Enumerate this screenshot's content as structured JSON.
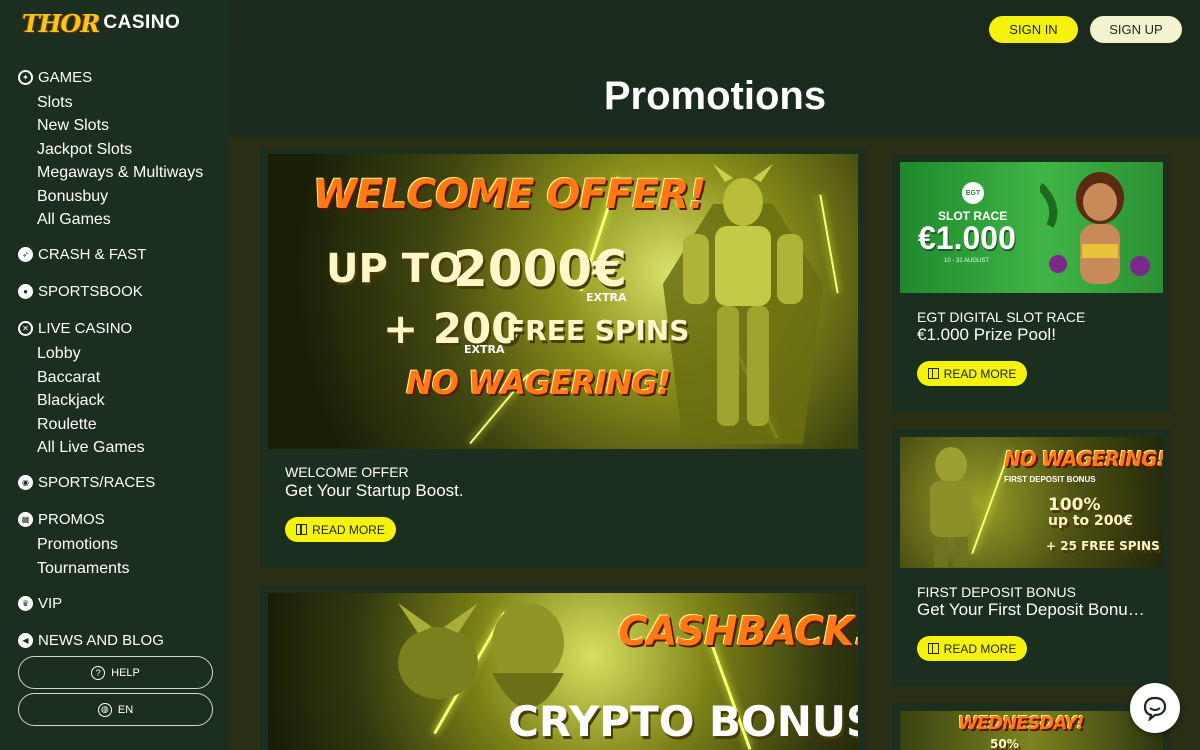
{
  "brand": {
    "logo_part1": "THOR",
    "logo_part2": "CASINO",
    "accent": "#f5f20e"
  },
  "header": {
    "sign_in": "SIGN IN",
    "sign_up": "SIGN UP"
  },
  "page_title": "Promotions",
  "sidebar": {
    "sections": [
      {
        "label": "GAMES",
        "icon": "games-icon",
        "items": [
          "Slots",
          "New Slots",
          "Jackpot Slots",
          "Megaways & Multiways",
          "Bonusbuy",
          "All Games"
        ]
      },
      {
        "label": "CRASH & FAST",
        "icon": "rocket-icon",
        "items": []
      },
      {
        "label": "SPORTSBOOK",
        "icon": "football-icon",
        "items": []
      },
      {
        "label": "LIVE CASINO",
        "icon": "chip-icon",
        "items": [
          "Lobby",
          "Baccarat",
          "Blackjack",
          "Roulette",
          "All Live Games"
        ]
      },
      {
        "label": "SPORTS/RACES",
        "icon": "gamepad-icon",
        "items": []
      },
      {
        "label": "PROMOS",
        "icon": "gift-icon",
        "items": [
          "Promotions",
          "Tournaments"
        ]
      },
      {
        "label": "VIP",
        "icon": "crown-icon",
        "items": []
      },
      {
        "label": "NEWS AND BLOG",
        "icon": "megaphone-icon",
        "items": []
      }
    ],
    "help_label": "HELP",
    "language_label": "EN"
  },
  "promos": {
    "welcome": {
      "kicker": "WELCOME OFFER",
      "subtitle": "Get Your Startup Boost.",
      "read_more": "READ MORE",
      "banner": {
        "title": "WELCOME OFFER!",
        "line1a": "UP TO",
        "line1b": "2000€",
        "extra1": "EXTRA",
        "line2a": "+ 200",
        "line2b": "FREE SPINS",
        "extra2": "EXTRA",
        "line3": "NO WAGERING!"
      }
    },
    "egt": {
      "kicker": "EGT DIGITAL SLOT RACE",
      "subtitle": "€1.000 Prize Pool!",
      "read_more": "READ MORE",
      "banner": {
        "badge": "EGT",
        "label": "SLOT RACE",
        "amount": "€1.000",
        "dates": "10 - 31 AUGUST"
      }
    },
    "first_deposit": {
      "kicker": "FIRST DEPOSIT BONUS",
      "subtitle": "Get Your First Deposit Bonus…",
      "read_more": "READ MORE",
      "banner": {
        "title": "NO WAGERING!!",
        "line1": "FIRST DEPOSIT BONUS",
        "line2": "100%",
        "line3": "up to 200€",
        "line4": "+ 25 FREE SPINS"
      }
    },
    "cashback": {
      "banner": {
        "title": "CASHBACK!",
        "line1": "CRYPTO BONUS"
      }
    },
    "wednesday": {
      "banner": {
        "title": "WEDNESDAY!",
        "line1": "50%"
      }
    }
  }
}
